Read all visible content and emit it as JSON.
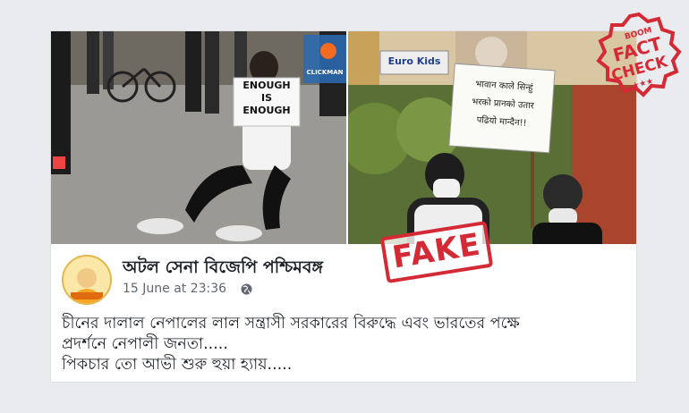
{
  "post": {
    "page_name": "অটল সেনা বিজেপি পশ্চিমবঙ্গ",
    "date": "15 June at 23:36",
    "text_lines": [
      "চীনের দালাল নেপালের লাল সন্ত্রাসী সরকারের বিরুদ্ধে এবং ভারতের পক্ষে",
      "প্রদর্শনে নেপালী জনতা.....",
      "পিকচার তো আভী শুরু হুয়া হ্যায়....."
    ]
  },
  "images": {
    "left_sign": [
      "ENOUGH",
      "IS",
      "ENOUGH"
    ],
    "watermark": "CLICKMAN",
    "right_banner": "Euro Kids",
    "right_sign": [
      "भावान काले सिन्हुं",
      "भरको प्रानको उतार",
      "पढियो मान्दैन!!"
    ]
  },
  "stamp": {
    "fake": "FAKE"
  },
  "badge": {
    "brand": "BOOM",
    "line1": "FACT",
    "line2": "CHECK"
  },
  "colors": {
    "stamp_red": "#d42a35",
    "fb_text": "#1d2129",
    "meta_grey": "#606770"
  }
}
